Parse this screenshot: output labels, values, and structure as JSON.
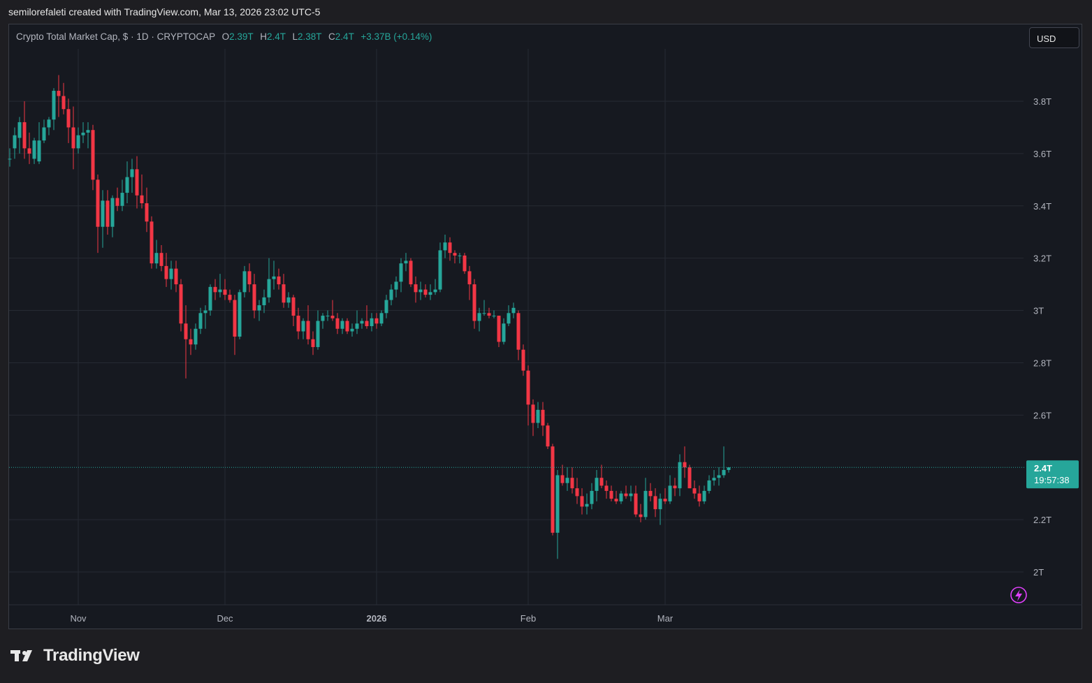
{
  "caption": "semilorefaleti created with TradingView.com, Mar 13, 2026 23:02 UTC-5",
  "legend": {
    "title": "Crypto Total Market Cap, $ · 1D · CRYPTOCAP",
    "o_key": "O",
    "o_val": "2.39T",
    "h_key": "H",
    "h_val": "2.4T",
    "l_key": "L",
    "l_val": "2.38T",
    "c_key": "C",
    "c_val": "2.4T",
    "change": "+3.37B (+0.14%)"
  },
  "currency_button": "USD",
  "brand": "TradingView",
  "colors": {
    "up": "#26a69a",
    "down": "#f23645",
    "background": "#161920",
    "grid": "#262a33"
  },
  "icons": [
    "tradingview-logo-icon",
    "lightning-icon"
  ],
  "chart_data": {
    "type": "candlestick",
    "title": "Crypto Total Market Cap, $ · 1D · CRYPTOCAP",
    "ylim": [
      1.85,
      4.1
    ],
    "y_ticks": [
      {
        "value": 3.8,
        "label": "3.8T"
      },
      {
        "value": 3.6,
        "label": "3.6T"
      },
      {
        "value": 3.4,
        "label": "3.4T"
      },
      {
        "value": 3.2,
        "label": "3.2T"
      },
      {
        "value": 3.0,
        "label": "3T"
      },
      {
        "value": 2.8,
        "label": "2.8T"
      },
      {
        "value": 2.6,
        "label": "2.6T"
      },
      {
        "value": 2.2,
        "label": "2.2T"
      },
      {
        "value": 2.0,
        "label": "2T"
      }
    ],
    "x_ticks": [
      {
        "index": 14,
        "label": "Nov",
        "bold": false
      },
      {
        "index": 44,
        "label": "Dec",
        "bold": false
      },
      {
        "index": 75,
        "label": "2026",
        "bold": true
      },
      {
        "index": 106,
        "label": "Feb",
        "bold": false
      },
      {
        "index": 134,
        "label": "Mar",
        "bold": false
      }
    ],
    "last_price": {
      "value": 2.4,
      "label": "2.4T",
      "countdown": "19:57:38"
    },
    "candles": [
      [
        3.58,
        3.62,
        3.55,
        3.58
      ],
      [
        3.62,
        3.7,
        3.58,
        3.67
      ],
      [
        3.66,
        3.74,
        3.6,
        3.72
      ],
      [
        3.72,
        3.8,
        3.58,
        3.62
      ],
      [
        3.62,
        3.68,
        3.56,
        3.6
      ],
      [
        3.58,
        3.66,
        3.56,
        3.65
      ],
      [
        3.57,
        3.72,
        3.56,
        3.65
      ],
      [
        3.65,
        3.73,
        3.64,
        3.7
      ],
      [
        3.7,
        3.74,
        3.67,
        3.73
      ],
      [
        3.73,
        3.85,
        3.69,
        3.84
      ],
      [
        3.84,
        3.9,
        3.74,
        3.82
      ],
      [
        3.82,
        3.87,
        3.75,
        3.77
      ],
      [
        3.77,
        3.81,
        3.64,
        3.7
      ],
      [
        3.7,
        3.78,
        3.54,
        3.62
      ],
      [
        3.62,
        3.7,
        3.6,
        3.67
      ],
      [
        3.67,
        3.72,
        3.64,
        3.68
      ],
      [
        3.68,
        3.72,
        3.62,
        3.69
      ],
      [
        3.69,
        3.71,
        3.46,
        3.5
      ],
      [
        3.5,
        3.52,
        3.22,
        3.32
      ],
      [
        3.32,
        3.46,
        3.24,
        3.42
      ],
      [
        3.42,
        3.46,
        3.29,
        3.32
      ],
      [
        3.32,
        3.44,
        3.28,
        3.43
      ],
      [
        3.43,
        3.47,
        3.38,
        3.4
      ],
      [
        3.4,
        3.5,
        3.38,
        3.45
      ],
      [
        3.45,
        3.57,
        3.41,
        3.51
      ],
      [
        3.51,
        3.58,
        3.45,
        3.54
      ],
      [
        3.54,
        3.59,
        3.39,
        3.44
      ],
      [
        3.44,
        3.52,
        3.39,
        3.41
      ],
      [
        3.41,
        3.47,
        3.3,
        3.34
      ],
      [
        3.34,
        3.36,
        3.16,
        3.18
      ],
      [
        3.18,
        3.27,
        3.16,
        3.22
      ],
      [
        3.22,
        3.25,
        3.15,
        3.17
      ],
      [
        3.17,
        3.22,
        3.09,
        3.12
      ],
      [
        3.12,
        3.19,
        3.08,
        3.16
      ],
      [
        3.16,
        3.19,
        3.07,
        3.1
      ],
      [
        3.1,
        3.12,
        2.92,
        2.95
      ],
      [
        2.95,
        3.02,
        2.74,
        2.89
      ],
      [
        2.89,
        2.93,
        2.83,
        2.87
      ],
      [
        2.87,
        2.95,
        2.85,
        2.93
      ],
      [
        2.93,
        3.01,
        2.91,
        2.99
      ],
      [
        2.99,
        3.02,
        2.93,
        3.0
      ],
      [
        3.0,
        3.1,
        2.98,
        3.09
      ],
      [
        3.09,
        3.12,
        3.04,
        3.07
      ],
      [
        3.07,
        3.14,
        3.05,
        3.08
      ],
      [
        3.08,
        3.12,
        3.04,
        3.06
      ],
      [
        3.06,
        3.08,
        3.03,
        3.04
      ],
      [
        3.04,
        3.06,
        2.83,
        2.9
      ],
      [
        2.9,
        3.08,
        2.89,
        3.07
      ],
      [
        3.07,
        3.17,
        3.05,
        3.15
      ],
      [
        3.15,
        3.18,
        3.07,
        3.1
      ],
      [
        3.1,
        3.14,
        2.97,
        3.0
      ],
      [
        3.0,
        3.04,
        2.96,
        3.02
      ],
      [
        3.02,
        3.08,
        2.99,
        3.05
      ],
      [
        3.05,
        3.2,
        3.03,
        3.12
      ],
      [
        3.12,
        3.19,
        3.08,
        3.13
      ],
      [
        3.13,
        3.16,
        3.08,
        3.1
      ],
      [
        3.1,
        3.14,
        3.01,
        3.03
      ],
      [
        3.03,
        3.07,
        3.01,
        3.05
      ],
      [
        3.05,
        3.06,
        2.94,
        2.98
      ],
      [
        2.98,
        3.01,
        2.89,
        2.92
      ],
      [
        2.92,
        2.97,
        2.89,
        2.96
      ],
      [
        2.96,
        3.02,
        2.87,
        2.89
      ],
      [
        2.89,
        2.92,
        2.83,
        2.86
      ],
      [
        2.86,
        3.0,
        2.85,
        2.96
      ],
      [
        2.96,
        2.99,
        2.93,
        2.98
      ],
      [
        2.98,
        3.0,
        2.96,
        2.98
      ],
      [
        2.98,
        3.04,
        2.96,
        2.97
      ],
      [
        2.97,
        2.99,
        2.91,
        2.93
      ],
      [
        2.93,
        2.97,
        2.91,
        2.96
      ],
      [
        2.96,
        2.97,
        2.91,
        2.92
      ],
      [
        2.92,
        2.95,
        2.9,
        2.93
      ],
      [
        2.93,
        3.0,
        2.91,
        2.95
      ],
      [
        2.95,
        2.97,
        2.93,
        2.96
      ],
      [
        2.96,
        3.02,
        2.93,
        2.94
      ],
      [
        2.94,
        2.99,
        2.92,
        2.97
      ],
      [
        2.97,
        2.99,
        2.93,
        2.95
      ],
      [
        2.95,
        3.0,
        2.94,
        2.99
      ],
      [
        2.99,
        3.06,
        2.97,
        3.04
      ],
      [
        3.04,
        3.1,
        3.02,
        3.08
      ],
      [
        3.08,
        3.13,
        3.05,
        3.11
      ],
      [
        3.11,
        3.2,
        3.07,
        3.18
      ],
      [
        3.18,
        3.22,
        3.15,
        3.19
      ],
      [
        3.19,
        3.2,
        3.09,
        3.1
      ],
      [
        3.1,
        3.13,
        3.03,
        3.07
      ],
      [
        3.07,
        3.11,
        3.04,
        3.08
      ],
      [
        3.08,
        3.1,
        3.05,
        3.06
      ],
      [
        3.06,
        3.1,
        3.04,
        3.07
      ],
      [
        3.07,
        3.12,
        3.06,
        3.08
      ],
      [
        3.08,
        3.26,
        3.07,
        3.23
      ],
      [
        3.23,
        3.29,
        3.2,
        3.26
      ],
      [
        3.26,
        3.28,
        3.19,
        3.22
      ],
      [
        3.22,
        3.23,
        3.18,
        3.21
      ],
      [
        3.21,
        3.22,
        3.18,
        3.21
      ],
      [
        3.21,
        3.22,
        3.14,
        3.15
      ],
      [
        3.15,
        3.17,
        3.04,
        3.1
      ],
      [
        3.1,
        3.12,
        2.93,
        2.96
      ],
      [
        2.96,
        3.01,
        2.92,
        2.99
      ],
      [
        2.99,
        3.04,
        2.98,
        2.99
      ],
      [
        2.99,
        3.01,
        2.97,
        2.98
      ],
      [
        2.98,
        3.0,
        2.97,
        2.98
      ],
      [
        2.98,
        2.98,
        2.86,
        2.88
      ],
      [
        2.88,
        2.97,
        2.87,
        2.95
      ],
      [
        2.95,
        3.02,
        2.94,
        2.99
      ],
      [
        2.99,
        3.03,
        2.97,
        3.01
      ],
      [
        2.99,
        3.0,
        2.81,
        2.85
      ],
      [
        2.85,
        2.87,
        2.75,
        2.77
      ],
      [
        2.77,
        2.79,
        2.56,
        2.64
      ],
      [
        2.64,
        2.66,
        2.52,
        2.57
      ],
      [
        2.57,
        2.65,
        2.55,
        2.62
      ],
      [
        2.62,
        2.65,
        2.52,
        2.56
      ],
      [
        2.56,
        2.57,
        2.47,
        2.48
      ],
      [
        2.48,
        2.49,
        2.14,
        2.15
      ],
      [
        2.15,
        2.39,
        2.05,
        2.37
      ],
      [
        2.37,
        2.41,
        2.33,
        2.34
      ],
      [
        2.34,
        2.4,
        2.31,
        2.36
      ],
      [
        2.36,
        2.4,
        2.3,
        2.32
      ],
      [
        2.32,
        2.36,
        2.26,
        2.29
      ],
      [
        2.29,
        2.32,
        2.22,
        2.25
      ],
      [
        2.25,
        2.3,
        2.22,
        2.26
      ],
      [
        2.26,
        2.34,
        2.24,
        2.31
      ],
      [
        2.31,
        2.39,
        2.27,
        2.36
      ],
      [
        2.36,
        2.41,
        2.32,
        2.33
      ],
      [
        2.33,
        2.35,
        2.28,
        2.31
      ],
      [
        2.31,
        2.33,
        2.27,
        2.28
      ],
      [
        2.28,
        2.31,
        2.26,
        2.27
      ],
      [
        2.27,
        2.31,
        2.26,
        2.3
      ],
      [
        2.3,
        2.33,
        2.28,
        2.29
      ],
      [
        2.29,
        2.33,
        2.27,
        2.3
      ],
      [
        2.3,
        2.33,
        2.21,
        2.22
      ],
      [
        2.22,
        2.26,
        2.19,
        2.21
      ],
      [
        2.21,
        2.36,
        2.2,
        2.31
      ],
      [
        2.31,
        2.34,
        2.27,
        2.29
      ],
      [
        2.29,
        2.32,
        2.21,
        2.24
      ],
      [
        2.24,
        2.3,
        2.18,
        2.28
      ],
      [
        2.28,
        2.32,
        2.26,
        2.27
      ],
      [
        2.27,
        2.37,
        2.26,
        2.33
      ],
      [
        2.33,
        2.36,
        2.29,
        2.32
      ],
      [
        2.32,
        2.45,
        2.29,
        2.42
      ],
      [
        2.42,
        2.48,
        2.36,
        2.4
      ],
      [
        2.4,
        2.41,
        2.32,
        2.32
      ],
      [
        2.32,
        2.35,
        2.28,
        2.3
      ],
      [
        2.3,
        2.33,
        2.25,
        2.27
      ],
      [
        2.27,
        2.33,
        2.26,
        2.31
      ],
      [
        2.31,
        2.37,
        2.3,
        2.35
      ],
      [
        2.35,
        2.39,
        2.33,
        2.36
      ],
      [
        2.36,
        2.4,
        2.33,
        2.37
      ],
      [
        2.37,
        2.48,
        2.36,
        2.39
      ],
      [
        2.39,
        2.4,
        2.38,
        2.4
      ]
    ]
  }
}
